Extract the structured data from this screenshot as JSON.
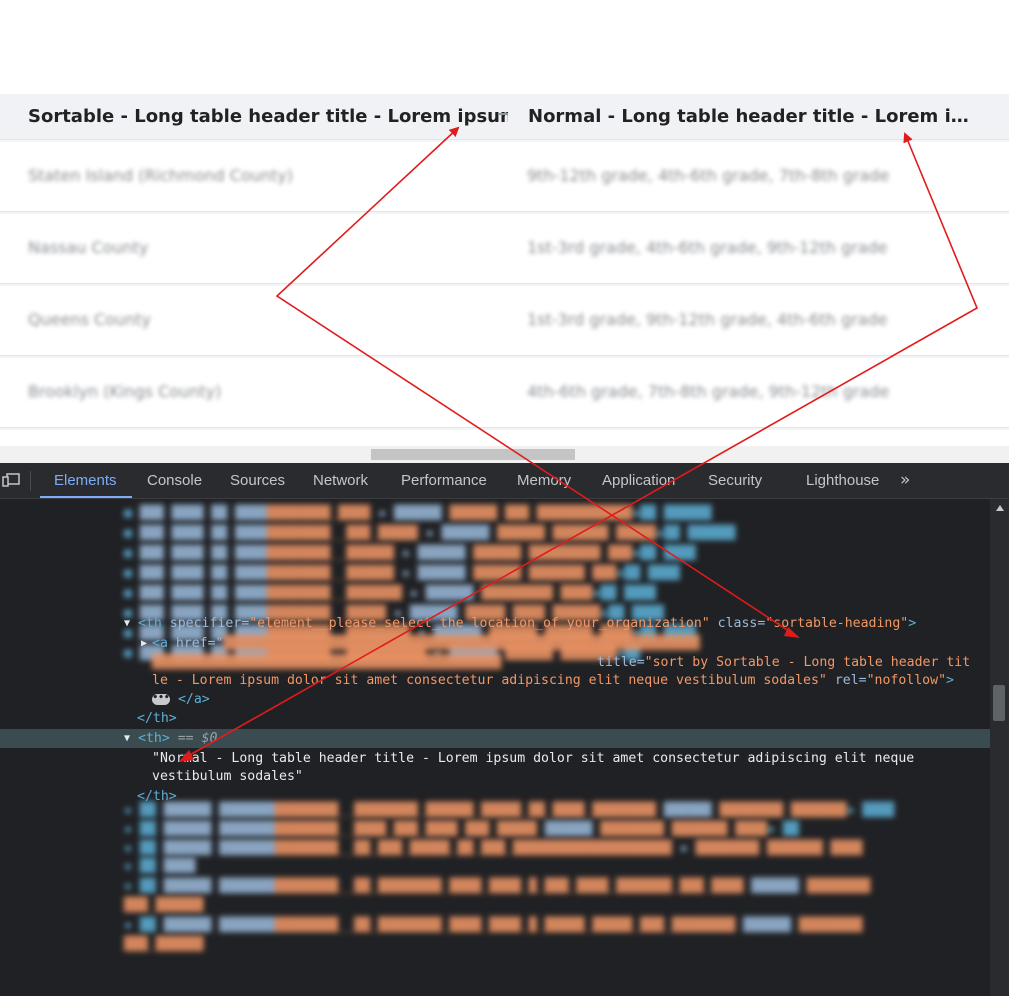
{
  "table": {
    "headers": {
      "sortable": "Sortable - Long table header title - Lorem ipsum dc",
      "normal": "Normal - Long table header title - Lorem ipsu…"
    },
    "rows": [
      {
        "col1": "Staten Island (Richmond County)",
        "col2": "9th-12th grade, 4th-6th grade, 7th-8th grade"
      },
      {
        "col1": "Nassau County",
        "col2": "1st-3rd grade, 4th-6th grade, 9th-12th grade"
      },
      {
        "col1": "Queens County",
        "col2": "1st-3rd grade, 9th-12th grade, 4th-6th grade"
      },
      {
        "col1": "Brooklyn (Kings County)",
        "col2": "4th-6th grade, 7th-8th grade, 9th-12th grade"
      }
    ]
  },
  "devtools": {
    "tabs": [
      "Elements",
      "Console",
      "Sources",
      "Network",
      "Performance",
      "Memory",
      "Application",
      "Security",
      "Lighthouse"
    ],
    "more_icon": "»",
    "code": {
      "th1_open_tag": "<th",
      "th1_attr1": "specifier",
      "th1_val1": "\"element__please_select_the_location_of_your_organization\"",
      "th1_attr2": "class",
      "th1_val2": "\"sortable-heading\"",
      "th1_close": ">",
      "a_open": "<a",
      "a_attr_href": "href",
      "a_title_attr": "title",
      "a_title_line1": "\"sort by Sortable - Long table header tit",
      "a_title_line2": "le - Lorem ipsum dolor sit amet consectetur adipiscing elit neque vestibulum sodales\"",
      "a_rel_attr": "rel",
      "a_rel_val": "\"nofollow\"",
      "a_close": "</a>",
      "th_close": "</th>",
      "th2_open": "<th>",
      "eq_dollar": "== $0",
      "th2_text_line1": "\"Normal - Long table header title - Lorem ipsum dolor sit amet consectetur adipiscing elit neque",
      "th2_text_line2": "vestibulum sodales\"",
      "th2_close": "</th>"
    }
  },
  "colors": {
    "annotation_arrow": "#e11b1b",
    "devtools_active_tab": "#7cacf8",
    "header_bg": "#f1f2f6"
  }
}
